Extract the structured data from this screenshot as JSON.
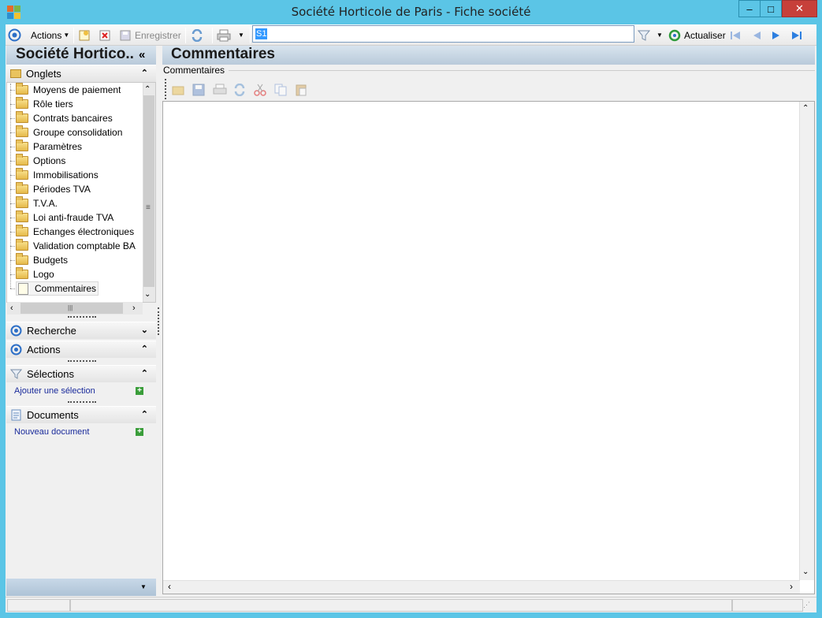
{
  "window": {
    "title": "Société Horticole de Paris -  Fiche société",
    "minimize": "–",
    "maximize": "□",
    "close": "✕"
  },
  "toolbar": {
    "actions_label": "Actions",
    "save_label": "Enregistrer",
    "search_value": "S1",
    "refresh_label": "Actualiser"
  },
  "left": {
    "title": "Société Hortico..",
    "collapse": "«",
    "tabs_section": "Onglets",
    "tree_items": [
      "Moyens de paiement",
      "Rôle tiers",
      "Contrats bancaires",
      "Groupe consolidation",
      "Paramètres",
      "Options",
      "Immobilisations",
      "Périodes TVA",
      "T.V.A.",
      "Loi anti-fraude TVA",
      "Echanges électroniques",
      "Validation comptable BA",
      "Budgets",
      "Logo",
      "Commentaires"
    ],
    "search_section": "Recherche",
    "actions_section": "Actions",
    "selections_section": "Sélections",
    "add_selection": "Ajouter une sélection",
    "documents_section": "Documents",
    "new_document": "Nouveau document"
  },
  "right": {
    "title": "Commentaires",
    "group_label": "Commentaires"
  },
  "colors": {
    "title_bar": "#5bc5e6",
    "close_button": "#c7403a",
    "link": "#1a2b9b"
  }
}
